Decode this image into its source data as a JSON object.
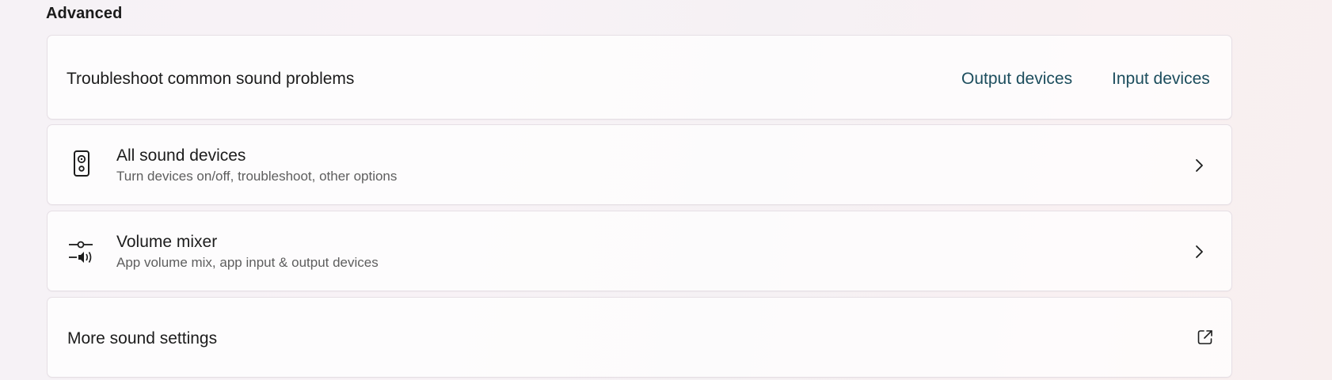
{
  "section": {
    "title": "Advanced"
  },
  "troubleshoot": {
    "label": "Troubleshoot common sound problems",
    "links": {
      "output": "Output devices",
      "input": "Input devices"
    }
  },
  "all_sound_devices": {
    "title": "All sound devices",
    "subtitle": "Turn devices on/off, troubleshoot, other options",
    "icon": "speaker-icon"
  },
  "volume_mixer": {
    "title": "Volume mixer",
    "subtitle": "App volume mix, app input & output devices",
    "icon": "volume-mixer-icon"
  },
  "more_sound_settings": {
    "label": "More sound settings",
    "icon": "open-external-icon"
  },
  "colors": {
    "link": "#1c4d5d",
    "text": "#1c1c1c",
    "subtext": "#5e5e5e"
  }
}
